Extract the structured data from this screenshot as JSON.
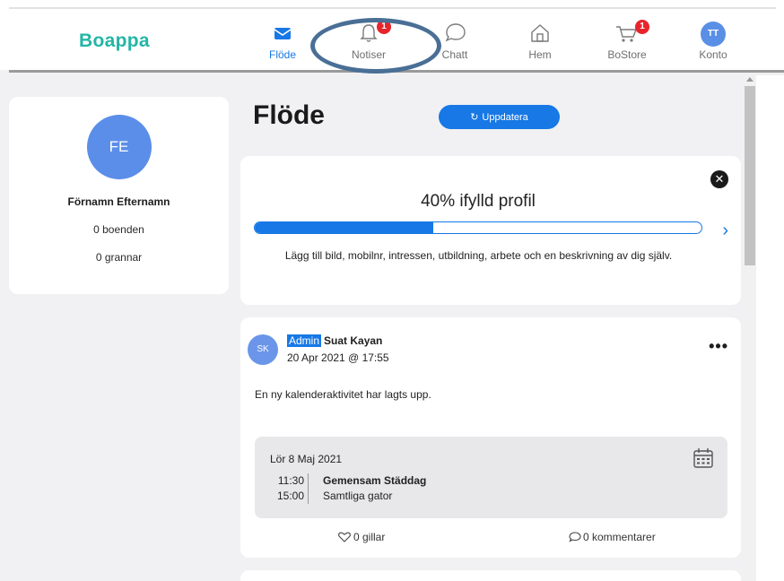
{
  "app": {
    "logo": "Boappa"
  },
  "nav": {
    "items": [
      {
        "label": "Flöde",
        "icon": "feed-icon",
        "active": true
      },
      {
        "label": "Notiser",
        "icon": "bell-icon",
        "badge": "1"
      },
      {
        "label": "Chatt",
        "icon": "chat-bubble-icon"
      },
      {
        "label": "Hem",
        "icon": "home-icon"
      },
      {
        "label": "BoStore",
        "icon": "cart-icon",
        "badge": "1"
      },
      {
        "label": "Konto",
        "icon": "account-avatar",
        "avatar_initials": "TT"
      }
    ]
  },
  "profile": {
    "initials": "FE",
    "name": "Förnamn Efternamn",
    "residences": "0 boenden",
    "neighbours": "0 grannar"
  },
  "feed": {
    "title": "Flöde",
    "refresh_label": "Uppdatera"
  },
  "profile_progress": {
    "title": "40% ifylld profil",
    "percent": 40,
    "description": "Lägg till bild, mobilnr, intressen, utbildning, arbete och en beskrivning av dig själv."
  },
  "post": {
    "avatar_initials": "SK",
    "role_tag": "Admin",
    "author": "Suat Kayan",
    "timestamp": "20 Apr 2021 @ 17:55",
    "text": "En ny kalenderaktivitet har lagts upp.",
    "event": {
      "date": "Lör 8 Maj 2021",
      "start": "11:30",
      "end": "15:00",
      "title": "Gemensam Städdag",
      "location": "Samtliga gator"
    },
    "likes": "0 gillar",
    "comments": "0 kommentarer"
  },
  "colors": {
    "brand": "#23b5a6",
    "accent": "#1778e6",
    "badge": "#e8242b",
    "highlight_ring": "#4a6f96"
  }
}
